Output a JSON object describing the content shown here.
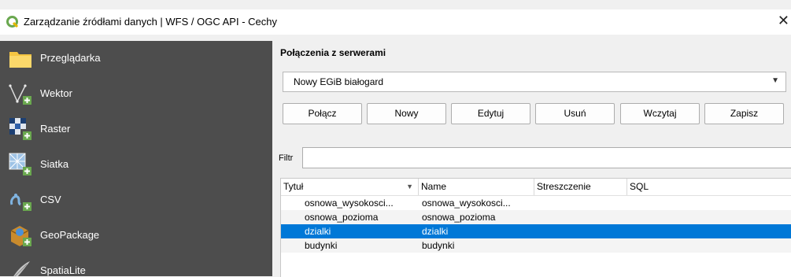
{
  "window": {
    "title": "Zarządzanie źródłami danych | WFS / OGC API - Cechy",
    "close_glyph": "✕"
  },
  "sidebar": {
    "items": [
      {
        "label": "Przeglądarka",
        "icon": "folder-icon"
      },
      {
        "label": "Wektor",
        "icon": "vector-add-icon"
      },
      {
        "label": "Raster",
        "icon": "raster-add-icon"
      },
      {
        "label": "Siatka",
        "icon": "mesh-add-icon"
      },
      {
        "label": "CSV",
        "icon": "csv-add-icon"
      },
      {
        "label": "GeoPackage",
        "icon": "geopackage-add-icon"
      },
      {
        "label": "SpatiaLite",
        "icon": "spatialite-add-icon"
      }
    ]
  },
  "connections": {
    "section_title": "Połączenia z serwerami",
    "selected": "Nowy EGiB białogard",
    "buttons": {
      "connect": "Połącz",
      "new": "Nowy",
      "edit": "Edytuj",
      "delete": "Usuń",
      "load": "Wczytaj",
      "save": "Zapisz"
    }
  },
  "filter": {
    "label": "Filtr",
    "value": ""
  },
  "table": {
    "columns": [
      "Tytuł",
      "Name",
      "Streszczenie",
      "SQL"
    ],
    "rows": [
      {
        "title": "osnowa_wysokosci...",
        "name": "osnowa_wysokosci..."
      },
      {
        "title": "osnowa_pozioma",
        "name": "osnowa_pozioma"
      },
      {
        "title": "dzialki",
        "name": "dzialki",
        "selected": true
      },
      {
        "title": "budynki",
        "name": "budynki"
      }
    ]
  },
  "colors": {
    "sidebar_bg": "#4d4d4d",
    "selection": "#0078d7",
    "qgis_green": "#6aa84f"
  }
}
